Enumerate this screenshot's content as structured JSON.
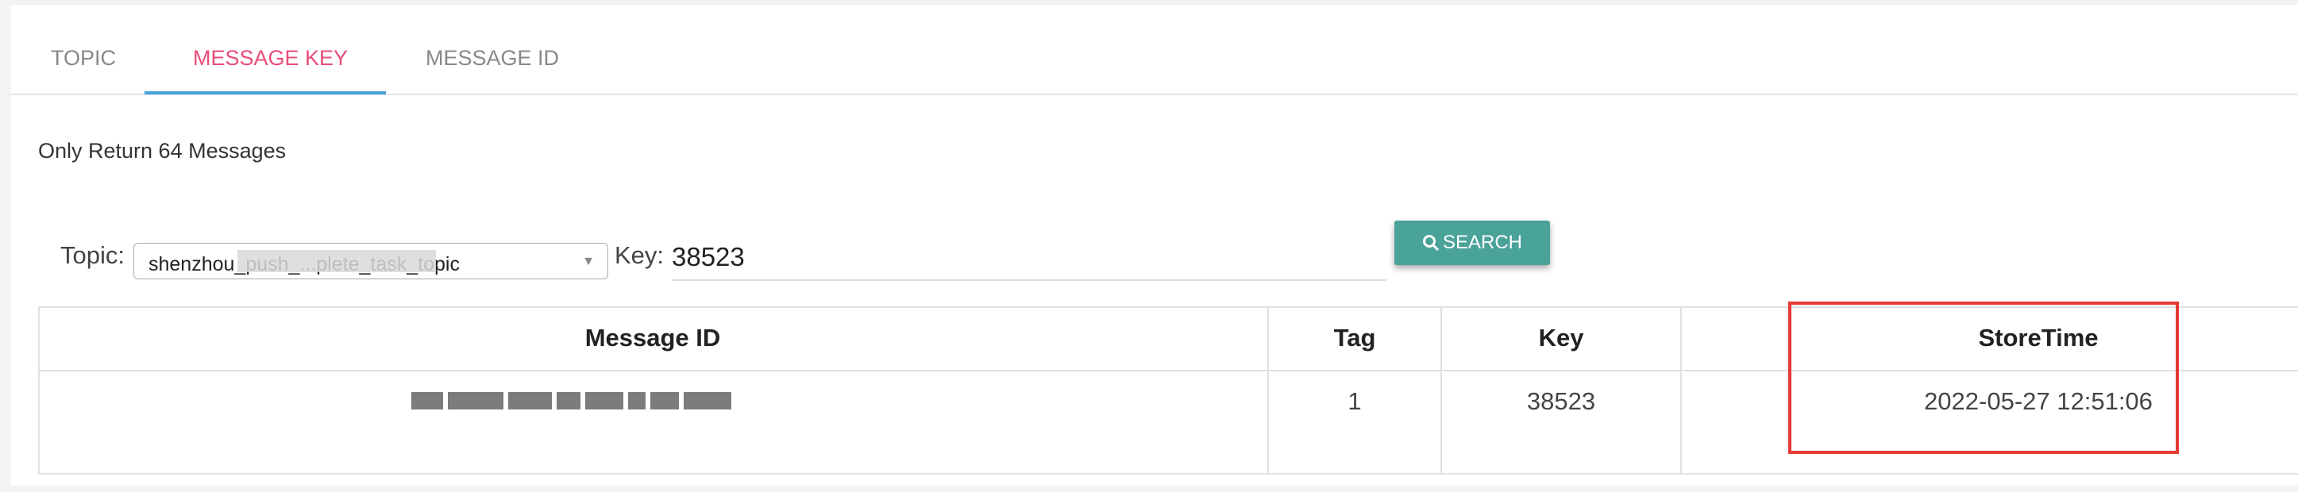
{
  "tabs": [
    {
      "label": "TOPIC",
      "active": false
    },
    {
      "label": "MESSAGE KEY",
      "active": true
    },
    {
      "label": "MESSAGE ID",
      "active": false
    }
  ],
  "notice": "Only Return 64 Messages",
  "form": {
    "topic_label": "Topic:",
    "topic_value": "shenzhou_push_...plete_task_topic",
    "key_label": "Key:",
    "key_value": "38523",
    "search_label": "SEARCH"
  },
  "table": {
    "headers": [
      "Message ID",
      "Tag",
      "Key",
      "StoreTime"
    ],
    "rows": [
      {
        "message_id": "",
        "tag": "1",
        "key": "38523",
        "store_time": "2022-05-27 12:51:06"
      }
    ]
  },
  "colors": {
    "active_tab": "#e84e79",
    "tab_underline": "#4aa3df",
    "search_button": "#4aa399",
    "highlight_box": "#e53935"
  }
}
